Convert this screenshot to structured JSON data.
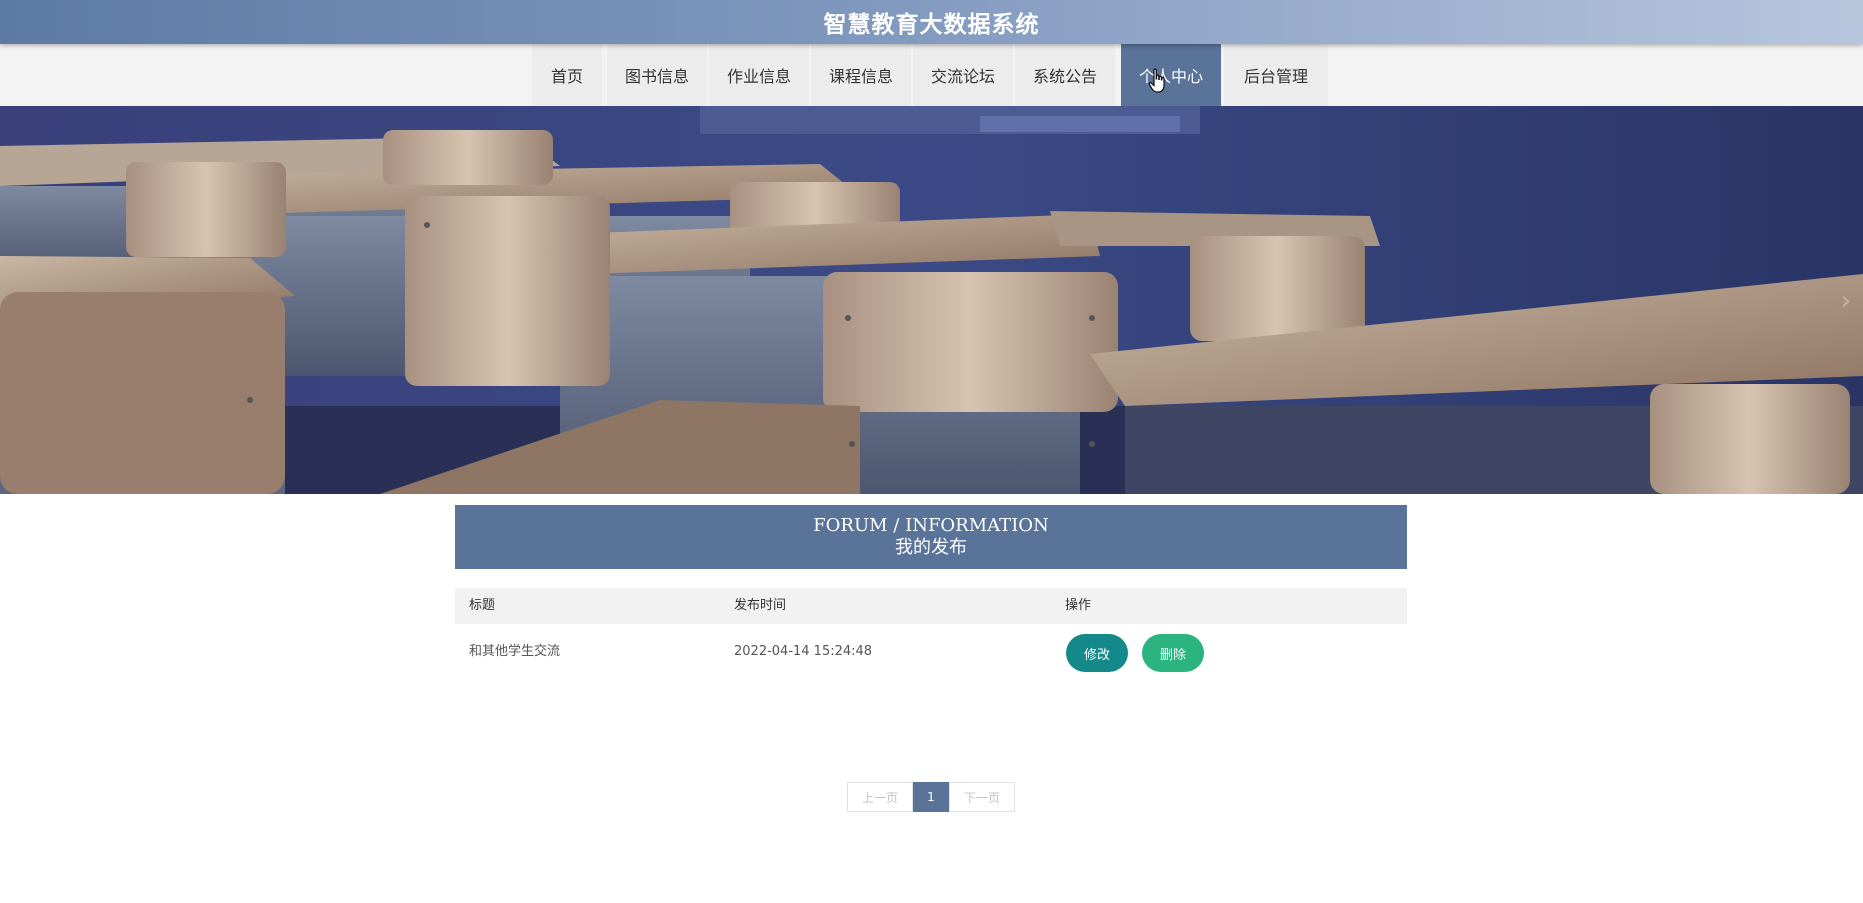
{
  "header": {
    "title": "智慧教育大数据系统"
  },
  "nav": {
    "items": [
      {
        "label": "首页"
      },
      {
        "label": "图书信息"
      },
      {
        "label": "作业信息"
      },
      {
        "label": "课程信息"
      },
      {
        "label": "交流论坛"
      },
      {
        "label": "系统公告"
      },
      {
        "label": "个人中心"
      },
      {
        "label": "后台管理"
      }
    ],
    "active": "个人中心"
  },
  "section": {
    "title_en": "FORUM / INFORMATION",
    "title_zh": "我的发布"
  },
  "table": {
    "headers": [
      "标题",
      "发布时间",
      "操作"
    ],
    "rows": [
      {
        "title": "和其他学生交流",
        "time": "2022-04-14 15:24:48",
        "edit_label": "修改",
        "delete_label": "删除"
      }
    ]
  },
  "pagination": {
    "prev": "上一页",
    "current": "1",
    "next": "下一页"
  },
  "colors": {
    "primary": "#5a7399",
    "edit": "#13898a",
    "delete": "#2bb380"
  }
}
